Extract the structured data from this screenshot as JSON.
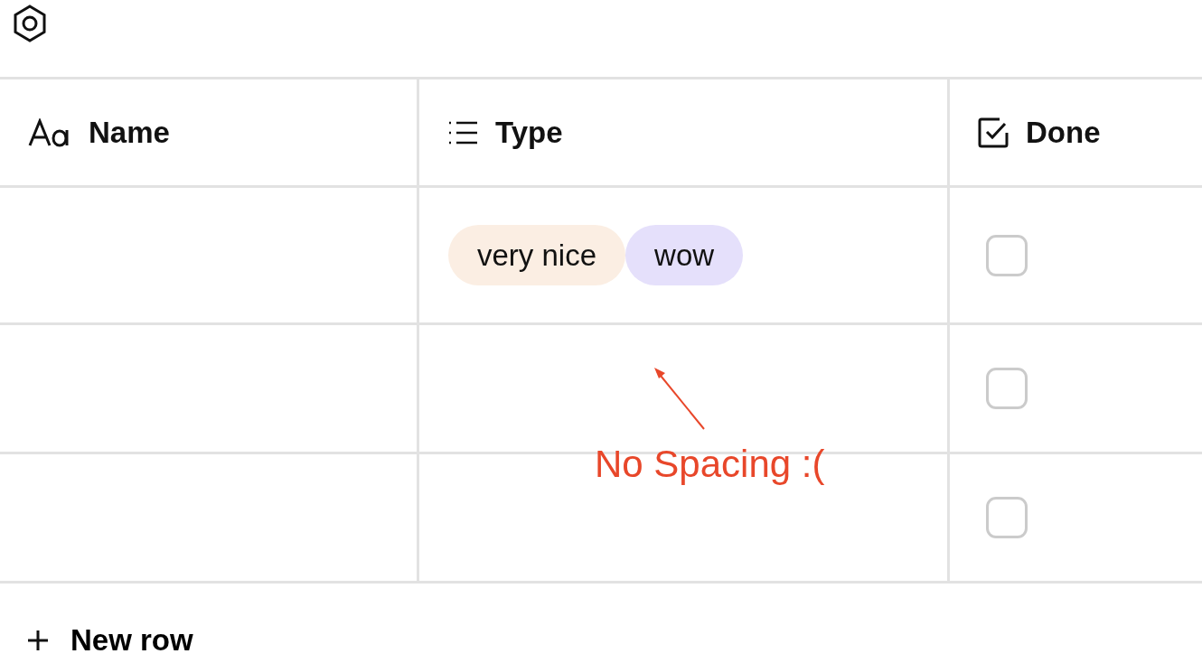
{
  "columns": [
    {
      "kind": "text",
      "label": "Name"
    },
    {
      "kind": "select",
      "label": "Type"
    },
    {
      "kind": "checkbox",
      "label": "Done"
    }
  ],
  "rows": [
    {
      "tags": [
        {
          "label": "very nice",
          "color": "#fbeee3"
        },
        {
          "label": "wow",
          "color": "#e5e0fb"
        }
      ],
      "checked": false
    },
    {
      "tags": [],
      "checked": false
    },
    {
      "tags": [],
      "checked": false
    }
  ],
  "annotation": {
    "text": "No Spacing :("
  },
  "new_row": {
    "label": "New row"
  }
}
